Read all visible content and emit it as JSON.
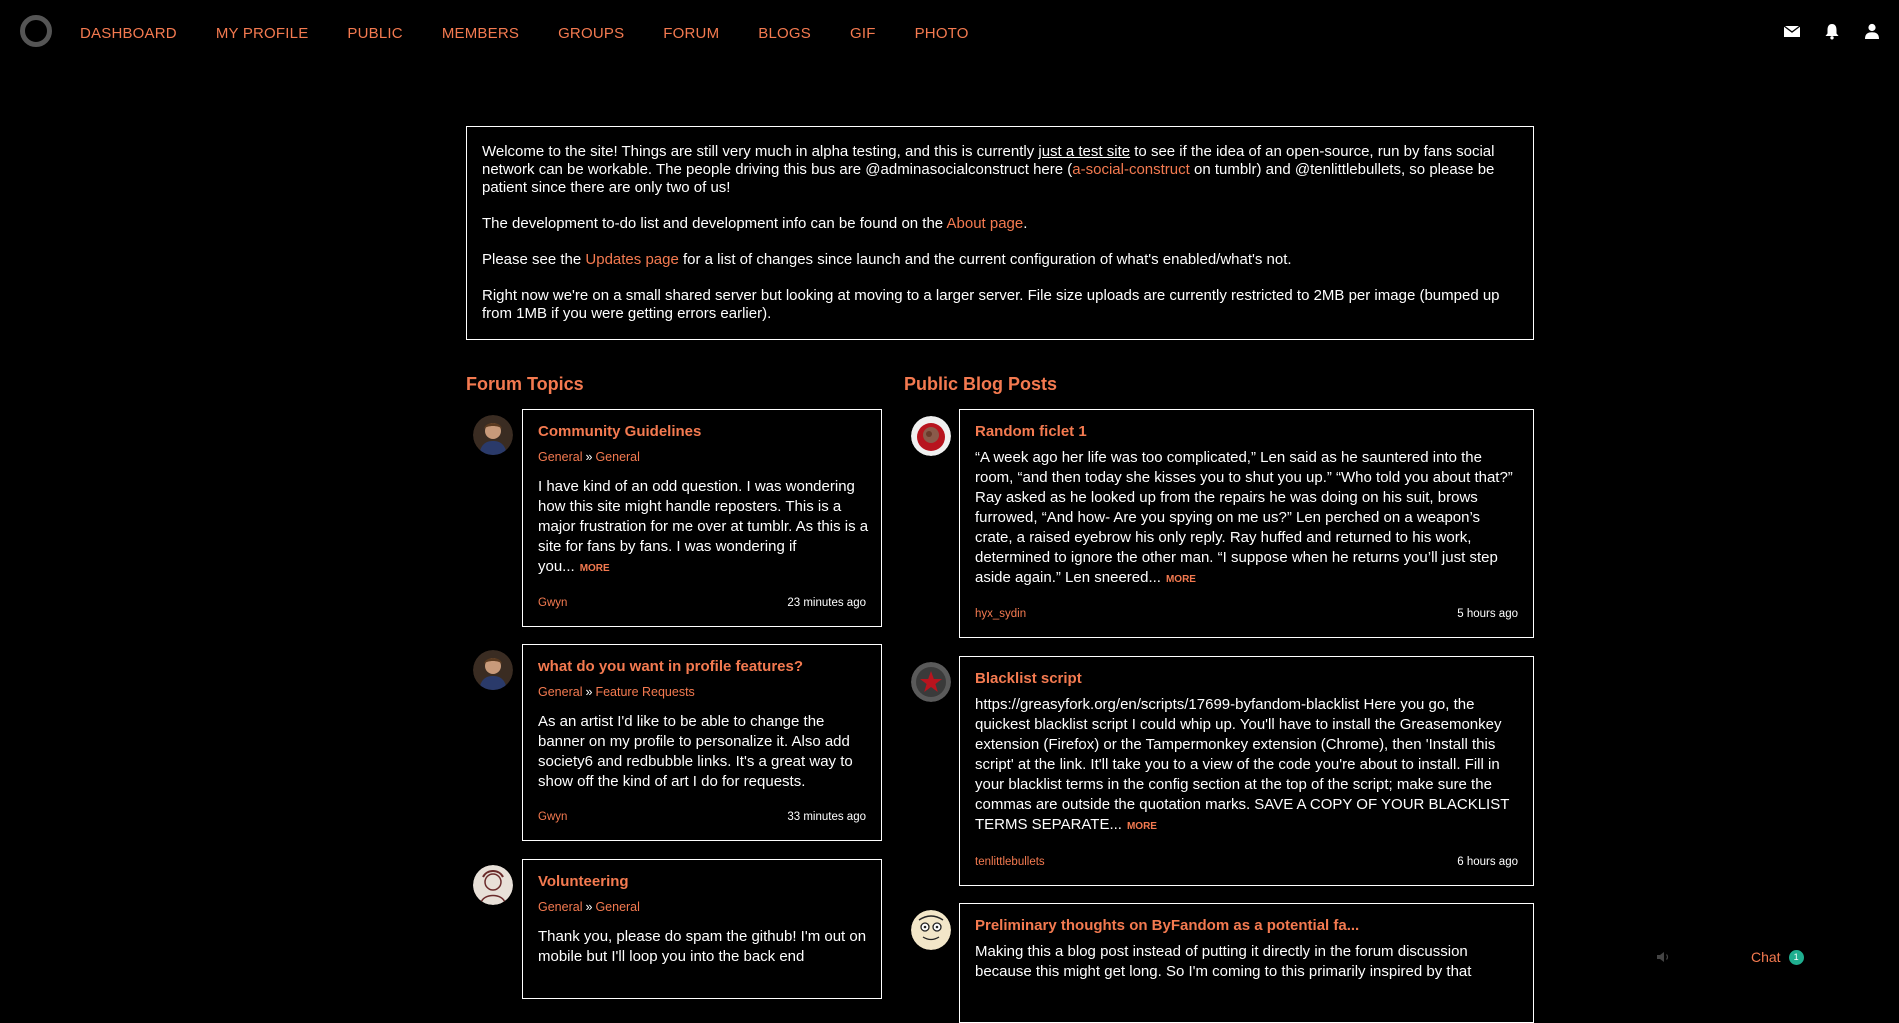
{
  "nav": {
    "items": [
      "DASHBOARD",
      "MY PROFILE",
      "PUBLIC",
      "MEMBERS",
      "GROUPS",
      "FORUM",
      "BLOGS",
      "GIF",
      "PHOTO"
    ],
    "icons": [
      "mail-icon",
      "bell-icon",
      "user-icon"
    ]
  },
  "welcome": {
    "p1_a": "Welcome to the site! Things are still very much in alpha testing, and this is currently ",
    "p1_link": "just a test site",
    "p1_b": " to see if the idea of an open-source, run by fans social network can be workable. The people driving this bus are @adminasocialconstruct here (",
    "p1_link2": "a-social-construct",
    "p1_c": " on tumblr) and @tenlittlebullets, so please be patient since there are only two of us!",
    "p2_a": "The development to-do list and development info can be found on the ",
    "p2_link": "About page",
    "p2_b": ".",
    "p3_a": "Please see the ",
    "p3_link": "Updates page",
    "p3_b": " for a list of changes since launch and the current configuration of what's enabled/what's not.",
    "p4": "Right now we're on a small shared server but looking at moving to a larger server. File size uploads are currently restricted to 2MB per image (bumped up from 1MB if you were getting errors earlier)."
  },
  "forum": {
    "title": "Forum Topics",
    "topics": [
      {
        "title": "Community Guidelines",
        "crumb_a": "General",
        "crumb_sep": "»",
        "crumb_b": "General",
        "body": "I have kind of an odd question. I was wondering how this site might handle reposters. This is a major frustration for me over at tumblr. As this is a site for fans by fans. I was wondering if you...",
        "more": "MORE",
        "author": "Gwyn",
        "time": "23 minutes ago"
      },
      {
        "title": "what do you want in profile features?",
        "crumb_a": "General",
        "crumb_sep": "»",
        "crumb_b": "Feature Requests",
        "body": "As an artist I'd like to be able to change the banner on my profile to personalize it. Also add society6 and redbubble links. It's a great way to show off the kind of art I do for requests.",
        "author": "Gwyn",
        "time": "33 minutes ago"
      },
      {
        "title": "Volunteering",
        "crumb_a": "General",
        "crumb_sep": "»",
        "crumb_b": "General",
        "body": "Thank you, please do spam the github!  I'm out on mobile but I'll loop you into the back end"
      }
    ]
  },
  "blogs": {
    "title": "Public Blog Posts",
    "posts": [
      {
        "title": "Random ficlet 1",
        "body": "“A week ago her life was too complicated,” Len said as he sauntered into the room, “and then today she kisses you to shut you up.” “Who told you about that?” Ray asked as he looked up from the repairs he was doing on his suit, brows furrowed, “And how- Are you spying on me us?” Len perched on a weapon’s crate, a raised eyebrow his only reply. Ray huffed and returned to his work, determined to ignore the other man. “I suppose when he returns you’ll just step aside again.” Len sneered...",
        "more": "MORE",
        "author": "hyx_sydin",
        "time": "5 hours ago"
      },
      {
        "title": "Blacklist script",
        "body": "https://greasyfork.org/en/scripts/17699-byfandom-blacklist Here you go, the quickest blacklist script I could whip up. You'll have to install the Greasemonkey extension (Firefox) or the Tampermonkey extension (Chrome), then 'Install this script' at the link. It'll take you to a view of the code you're about to install. Fill in your blacklist terms in the config section at the top of the script; make sure the commas are outside the quotation marks. SAVE A COPY OF YOUR BLACKLIST TERMS SEPARATE...",
        "more": "MORE",
        "author": "tenlittlebullets",
        "time": "6 hours ago"
      },
      {
        "title": "Preliminary thoughts on ByFandom as a potential fa...",
        "body": "Making this a blog post instead of putting it directly in the forum discussion because this might get long. So I'm coming to this primarily inspired by that"
      }
    ]
  },
  "chat": {
    "label": "Chat",
    "count": "1"
  },
  "colors": {
    "accent": "#f47a50",
    "badge": "#1fae8f"
  }
}
